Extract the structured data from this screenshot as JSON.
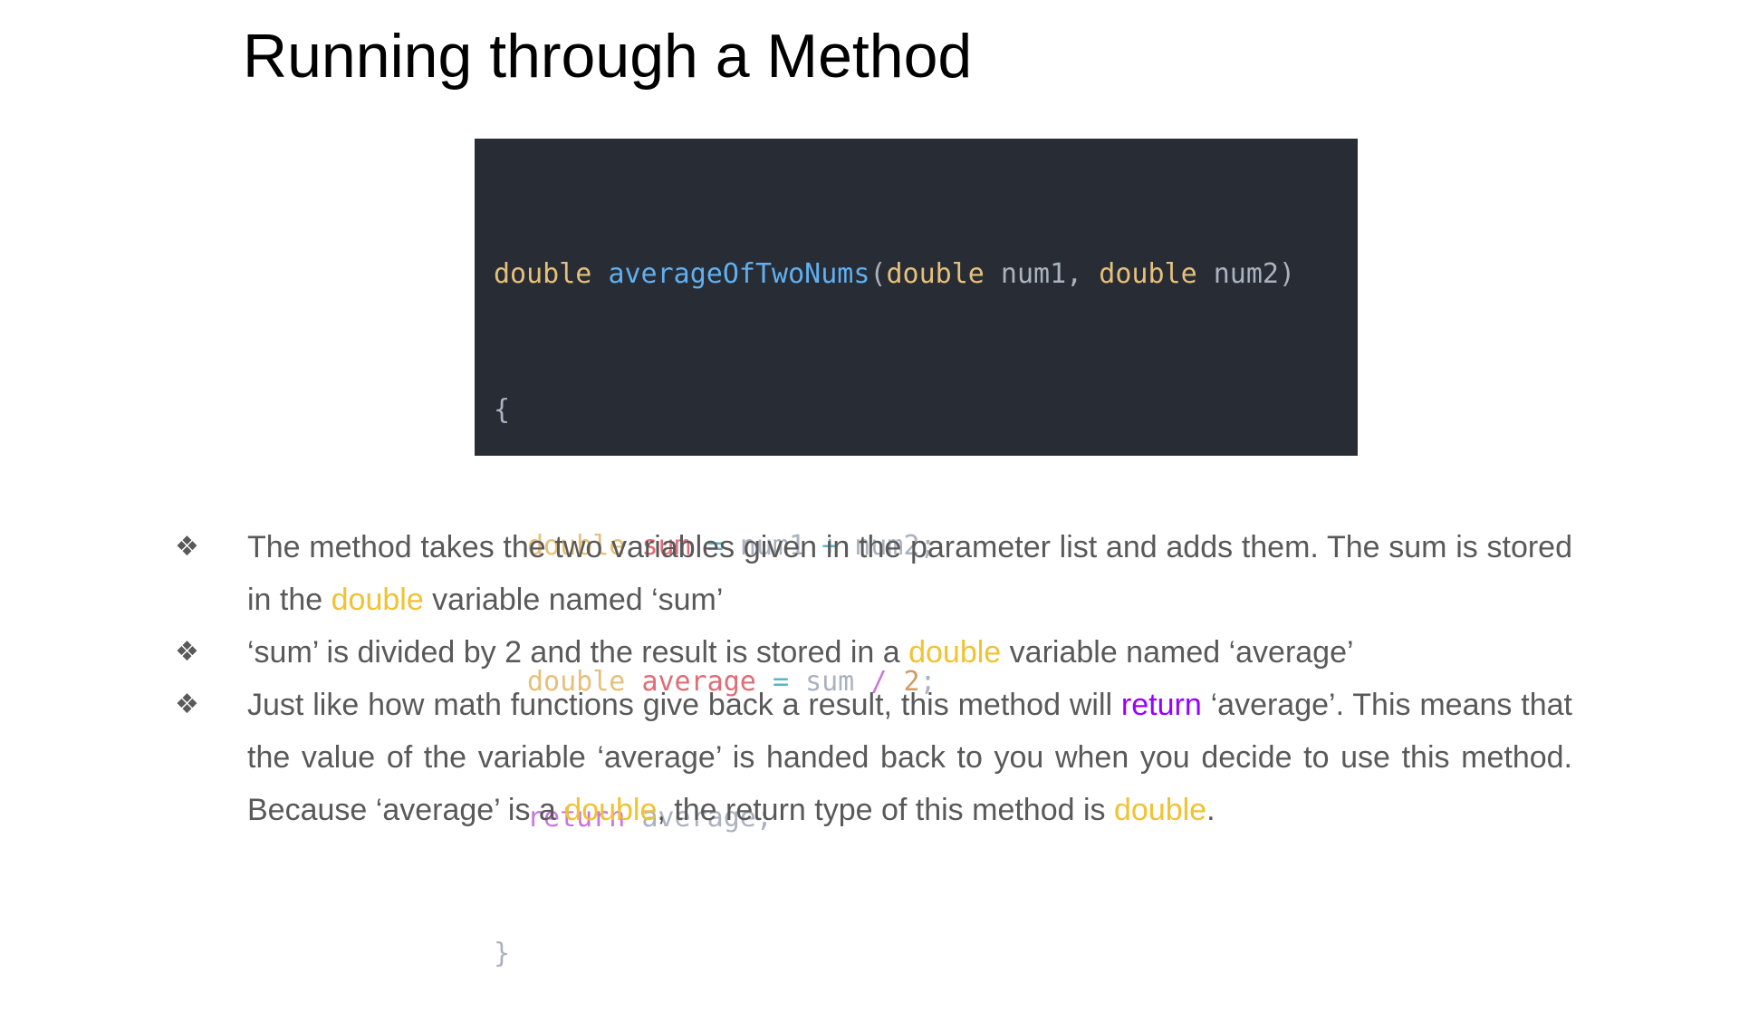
{
  "slide": {
    "title": "Running through a Method"
  },
  "code": {
    "line1": {
      "type": "double",
      "name": "averageOfTwoNums",
      "open_paren": "(",
      "param1_type": "double",
      "param1_name": "num1,",
      "param2_type": "double",
      "param2_name": "num2)"
    },
    "line2": {
      "brace": "{"
    },
    "line3": {
      "type": "double",
      "var": "sum",
      "eq": "=",
      "a": "num1",
      "plus": "+",
      "b": "num2;"
    },
    "line4": {
      "type": "double",
      "var": "average",
      "eq": "=",
      "a": "sum",
      "slash": "/",
      "num": "2",
      "semi": ";"
    },
    "line5": {
      "keyword": "return",
      "value": "average;"
    },
    "line6": {
      "brace": "}"
    }
  },
  "bullets": {
    "marker": "❖",
    "b1": {
      "text_a": "The method takes the two variables given in the parameter list and adds them. The sum is stored in the ",
      "hl": "double",
      "text_b": " variable named ‘sum’"
    },
    "b2": {
      "text_a": "‘sum’ is divided by 2 and the result is stored in a ",
      "hl": "double",
      "text_b": " variable named ‘average’"
    },
    "b3": {
      "text_a": "Just like how math functions give back a result, this method will ",
      "hl_return": "return",
      "text_b": " ‘average’. This means that the value of the variable ‘average’ is handed back to you when you decide to use this method. Because ‘average’ is a ",
      "hl1": "double",
      "text_c": ", the return type of this method is ",
      "hl2": "double",
      "text_d": "."
    }
  },
  "colors": {
    "highlight_type": "#f1c232",
    "highlight_return": "#9900ff",
    "body_text": "#595959",
    "code_background": "#282c34"
  }
}
